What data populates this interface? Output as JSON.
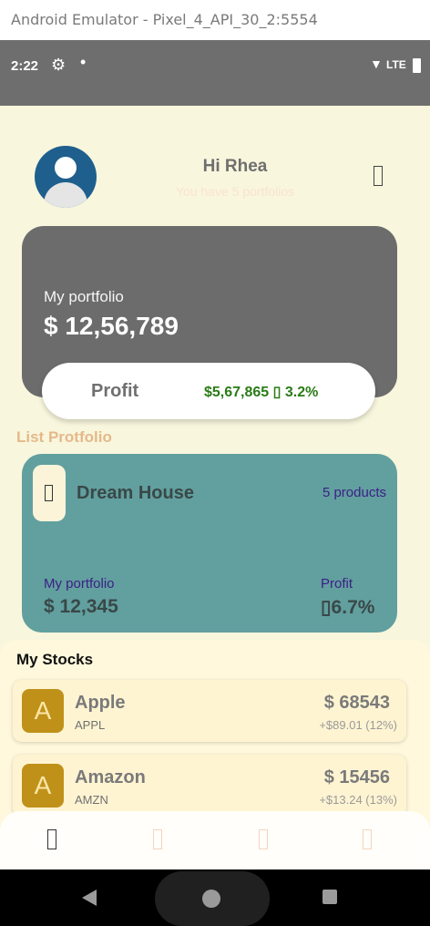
{
  "window": {
    "title": "Android Emulator - Pixel_4_API_30_2:5554"
  },
  "status_bar": {
    "time": "2:22",
    "network": "LTE"
  },
  "header": {
    "greeting": "Hi Rhea",
    "subtitle": "You have 5 portfolios"
  },
  "portfolio_card": {
    "label": "My portfolio",
    "value": "$ 12,56,789",
    "profit_label": "Profit",
    "profit_value": "$5,67,865 ▯ 3.2%"
  },
  "list_portfolio": {
    "title": "List Protfolio",
    "items": [
      {
        "name": "Dream House",
        "count": "5 products",
        "portfolio_label": "My portfolio",
        "portfolio_value": "$ 12,345",
        "profit_label": "Profit",
        "profit_value": "▯6.7%"
      }
    ]
  },
  "stocks": {
    "title": "My Stocks",
    "items": [
      {
        "letter": "A",
        "name": "Apple",
        "ticker": "APPL",
        "price": "$ 68543",
        "change": "+$89.01 (12%)"
      },
      {
        "letter": "A",
        "name": "Amazon",
        "ticker": "AMZN",
        "price": "$ 15456",
        "change": "+$13.24 (13%)"
      }
    ]
  },
  "bottom_nav": {
    "icons": [
      "home-icon",
      "wallet-icon",
      "chart-icon",
      "profile-icon"
    ],
    "active_color": "#333333",
    "inactive_color": "#f4d4bd"
  },
  "colors": {
    "card_dark": "#6c6c6c",
    "teal_card": "#629f9f",
    "profit_green": "#2a7b16",
    "accent_gold": "#c09119",
    "background": "#f8f6dd"
  }
}
